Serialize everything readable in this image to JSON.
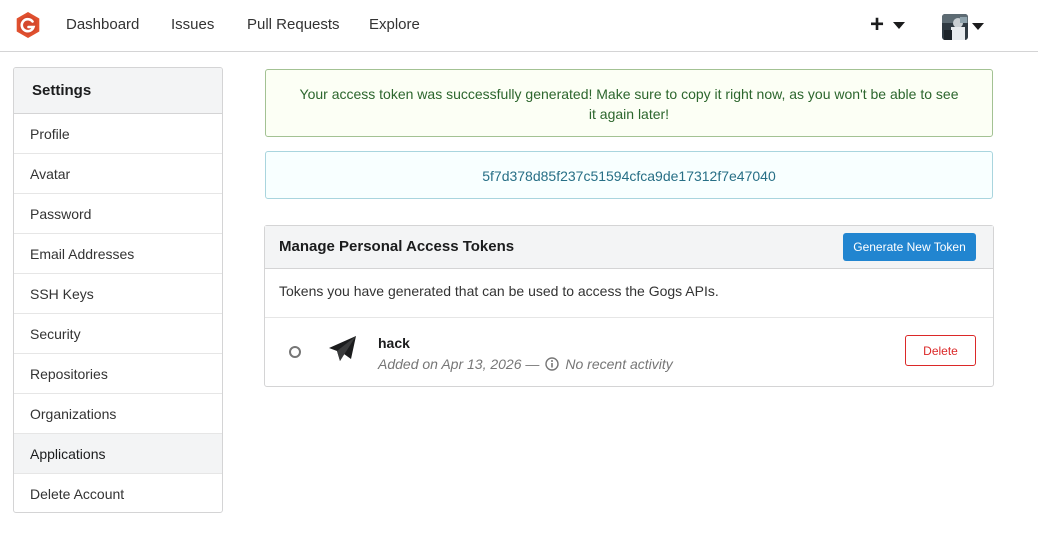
{
  "nav": {
    "items": [
      "Dashboard",
      "Issues",
      "Pull Requests",
      "Explore"
    ],
    "plus_symbol": "+"
  },
  "sidebar": {
    "title": "Settings",
    "items": [
      {
        "label": "Profile"
      },
      {
        "label": "Avatar"
      },
      {
        "label": "Password"
      },
      {
        "label": "Email Addresses"
      },
      {
        "label": "SSH Keys"
      },
      {
        "label": "Security"
      },
      {
        "label": "Repositories"
      },
      {
        "label": "Organizations"
      },
      {
        "label": "Applications",
        "active": true
      },
      {
        "label": "Delete Account"
      }
    ]
  },
  "messages": {
    "success": "Your access token was successfully generated! Make sure to copy it right now, as you won't be able to see it again later!",
    "token_value": "5f7d378d85f237c51594cfca9de17312f7e47040"
  },
  "tokens_panel": {
    "title": "Manage Personal Access Tokens",
    "generate_button": "Generate New Token",
    "description": "Tokens you have generated that can be used to access the Gogs APIs.",
    "tokens": [
      {
        "name": "hack",
        "added_text": "Added on Apr 13, 2026 —",
        "activity_text": "No recent activity",
        "delete_label": "Delete"
      }
    ]
  },
  "icons": {
    "logo": "gogs-logo-icon",
    "token": "send-icon",
    "info": "info-circle-icon"
  },
  "colors": {
    "brand": "#e0502e",
    "primary_button": "#2185d0",
    "danger": "#db2828",
    "success_text": "#2c662d",
    "info_text": "#276f86"
  }
}
